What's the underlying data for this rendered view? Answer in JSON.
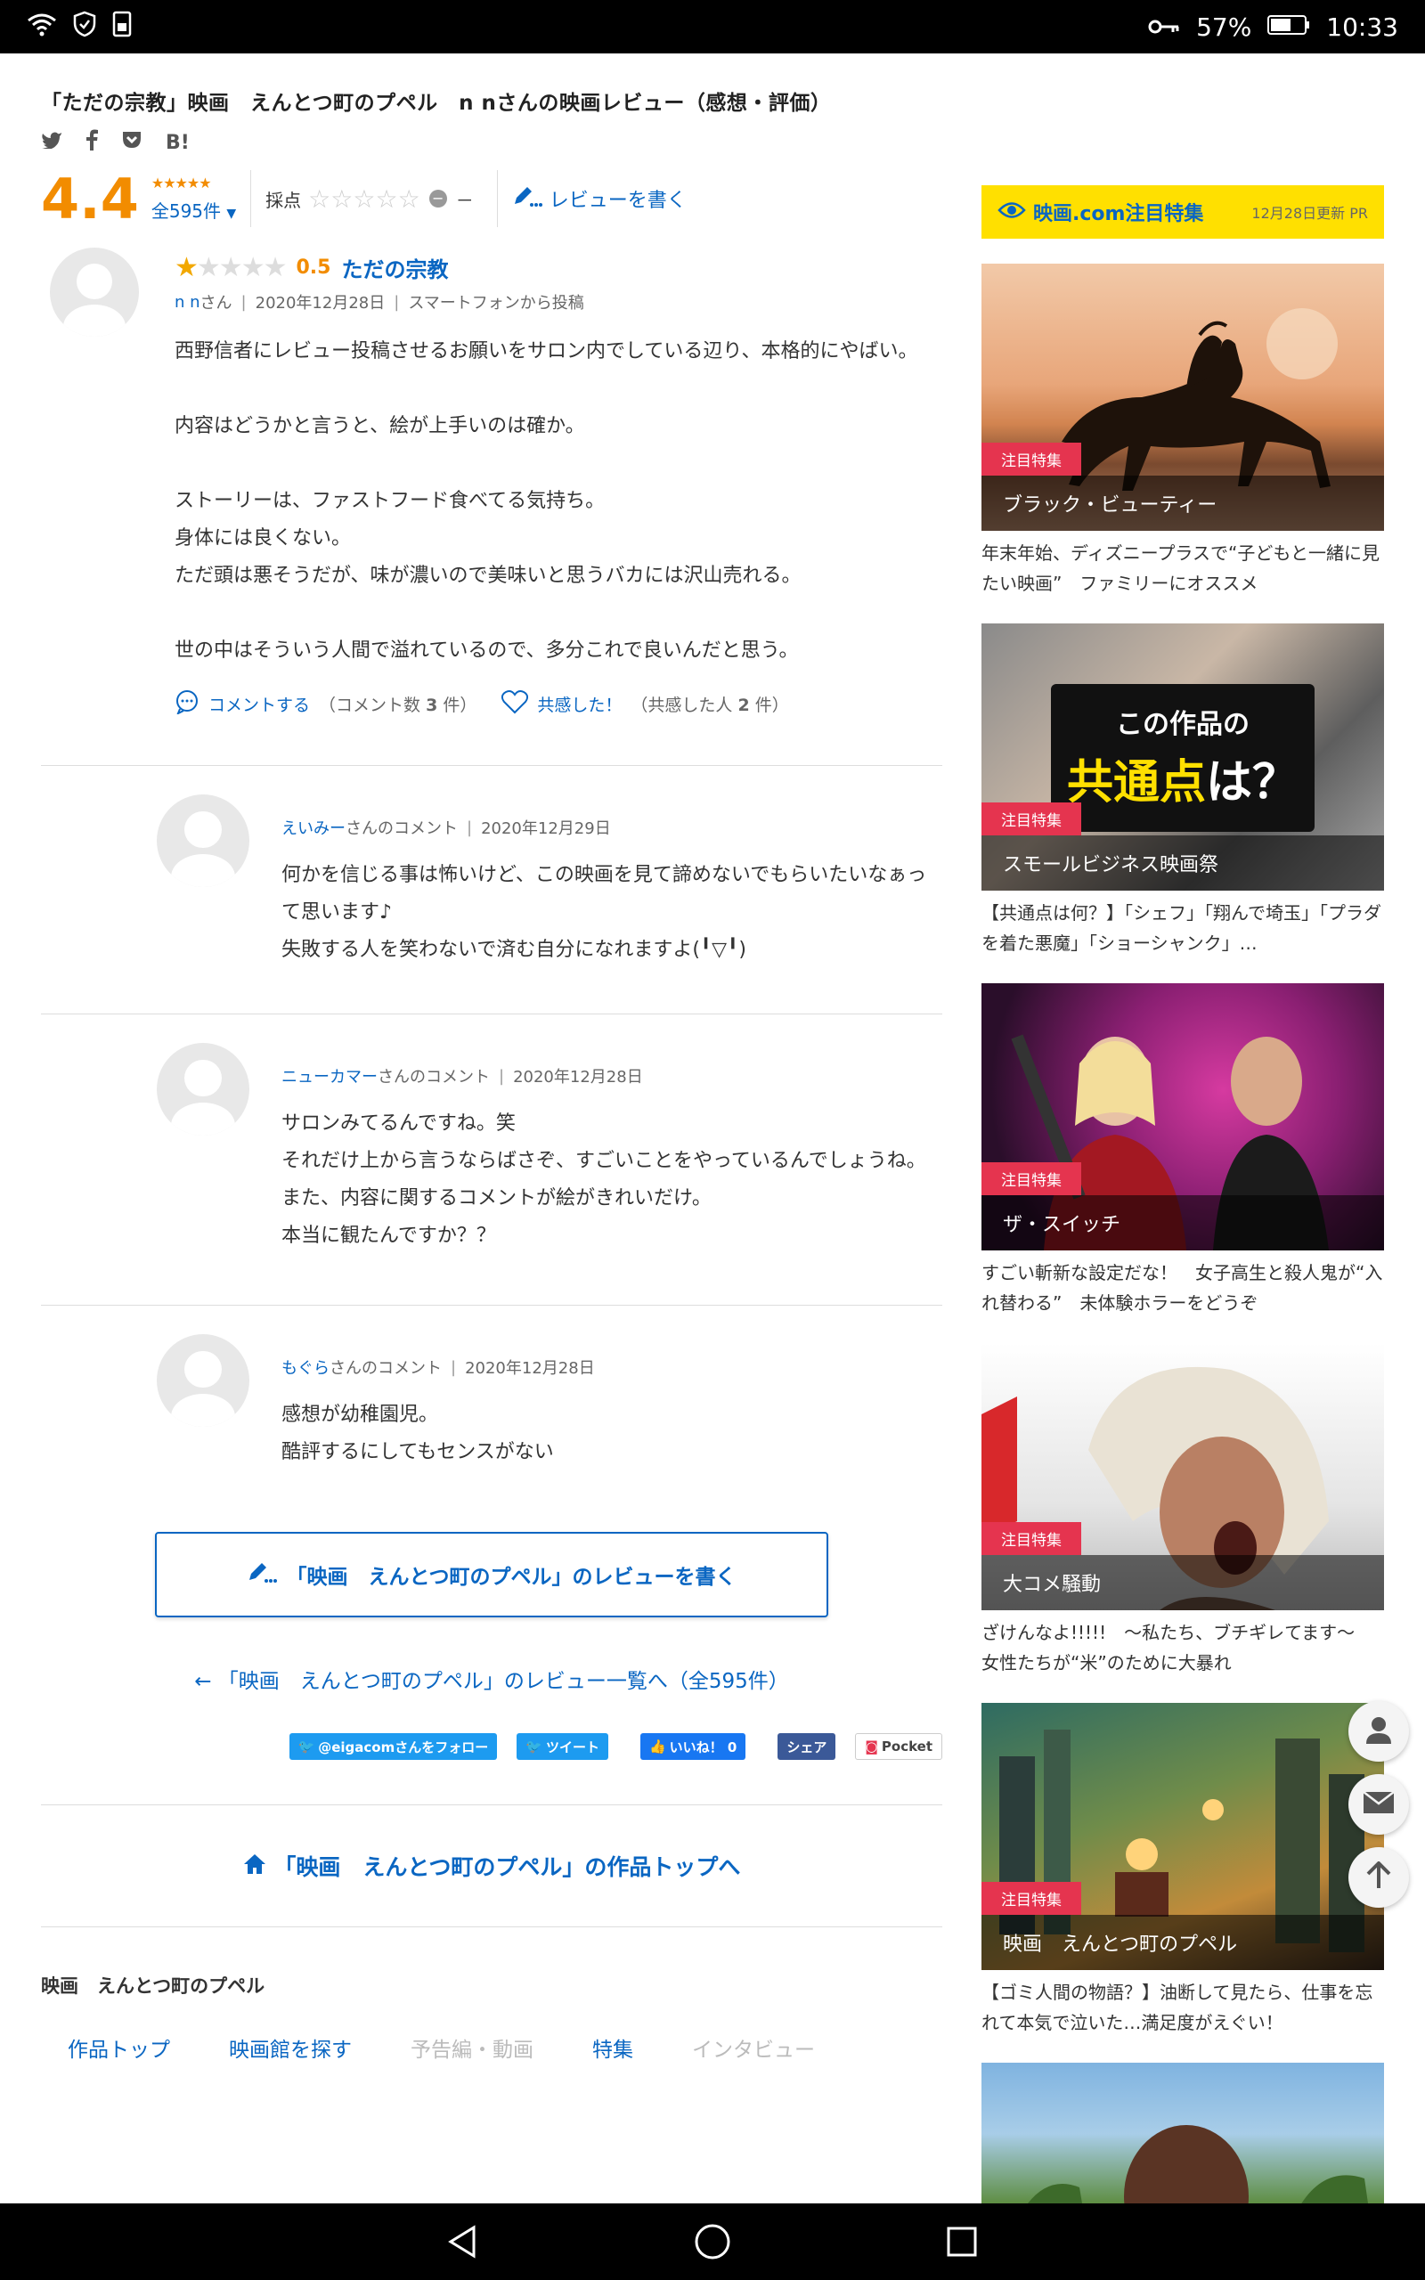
{
  "status": {
    "battery": "57%",
    "time": "10:33"
  },
  "page": {
    "title": "「ただの宗教」映画　えんとつ町のプペル　n nさんの映画レビュー（感想・評価）",
    "share_icons": [
      "twitter-icon",
      "facebook-icon",
      "pocket-icon",
      "hatena-icon"
    ],
    "hatena_label": "B!"
  },
  "rating": {
    "average": "4.4",
    "total_link": "全595件",
    "score_label": "採点",
    "score_value": "－",
    "write_review": "レビューを書く"
  },
  "review": {
    "score": "0.5",
    "stars_filled": 0.5,
    "title": "ただの宗教",
    "user": "n n",
    "user_suffix": "さん",
    "date": "2020年12月28日",
    "device": "スマートフォンから投稿",
    "text": "西野信者にレビュー投稿させるお願いをサロン内でしている辺り、本格的にやばい。\n\n内容はどうかと言うと、絵が上手いのは確か。\n\nストーリーは、ファストフード食べてる気持ち。\n身体には良くない。\nただ頭は悪そうだが、味が濃いので美味いと思うバカには沢山売れる。\n\n世の中はそういう人間で溢れているので、多分これで良いんだと思う。",
    "comment_action": "コメントする",
    "comment_count_pre": "（コメント数",
    "comment_count": "3",
    "comment_count_post": "件）",
    "like_action": "共感した！",
    "like_count_pre": "（共感した人",
    "like_count": "2",
    "like_count_post": "件）"
  },
  "comments": [
    {
      "user": "えいみー",
      "suffix": "さんのコメント",
      "date": "2020年12月29日",
      "text": "何かを信じる事は怖いけど、この映画を見て諦めないでもらいたいなぁって思います♪\n失敗する人を笑わないで済む自分になれますよ(╹▽╹)"
    },
    {
      "user": "ニューカマー",
      "suffix": "さんのコメント",
      "date": "2020年12月28日",
      "text": "サロンみてるんですね。笑\nそれだけ上から言うならばさぞ、すごいことをやっているんでしょうね。また、内容に関するコメントが絵がきれいだけ。\n本当に観たんですか？？"
    },
    {
      "user": "もぐら",
      "suffix": "さんのコメント",
      "date": "2020年12月28日",
      "text": "感想が幼稚園児。\n酷評するにしてもセンスがない"
    }
  ],
  "buttons": {
    "write_movie_review": "「映画　えんとつ町のプペル」のレビューを書く",
    "review_list": "「映画　えんとつ町のプペル」のレビュー一覧へ（全595件）",
    "movie_top": "「映画　えんとつ町のプペル」の作品トップへ"
  },
  "social": {
    "follow": "@eigacomさんをフォロー",
    "tweet": "ツイート",
    "like": "いいね！ 0",
    "share": "シェア",
    "pocket": "Pocket"
  },
  "movie_nav": {
    "name": "映画　えんとつ町のプペル",
    "tabs": [
      {
        "label": "作品トップ",
        "active": true
      },
      {
        "label": "映画館を探す",
        "active": true
      },
      {
        "label": "予告編・動画",
        "active": false
      },
      {
        "label": "特集",
        "active": true
      },
      {
        "label": "インタビュー",
        "active": false
      }
    ]
  },
  "sidebar": {
    "header_title": "映画.com注目特集",
    "header_date": "12月28日更新 PR",
    "cards": [
      {
        "badge": "注目特集",
        "caption": "ブラック・ビューティー",
        "desc": "年末年始、ディズニープラスで“子どもと一緒に見たい映画”　ファミリーにオススメ"
      },
      {
        "badge": "注目特集",
        "caption": "スモールビジネス映画祭",
        "overlay_line1": "この作品の",
        "overlay_line2a": "共通点",
        "overlay_line2b": "は？",
        "desc": "【共通点は何？】「シェフ」「翔んで埼玉」「プラダを着た悪魔」「ショーシャンク」…"
      },
      {
        "badge": "注目特集",
        "caption": "ザ・スイッチ",
        "desc": "すごい斬新な設定だな！　女子高生と殺人鬼が“入れ替わる”　未体験ホラーをどうぞ"
      },
      {
        "badge": "注目特集",
        "caption": "大コメ騒動",
        "desc": "ざけんなよ!!!!!　～私たち、ブチギレてます～　女性たちが“米”のために大暴れ"
      },
      {
        "badge": "注目特集",
        "caption": "映画　えんとつ町のプペル",
        "desc": "【ゴミ人間の物語？】油断して見たら、仕事を忘れて本気で泣いた…満足度がえぐい！"
      }
    ]
  }
}
